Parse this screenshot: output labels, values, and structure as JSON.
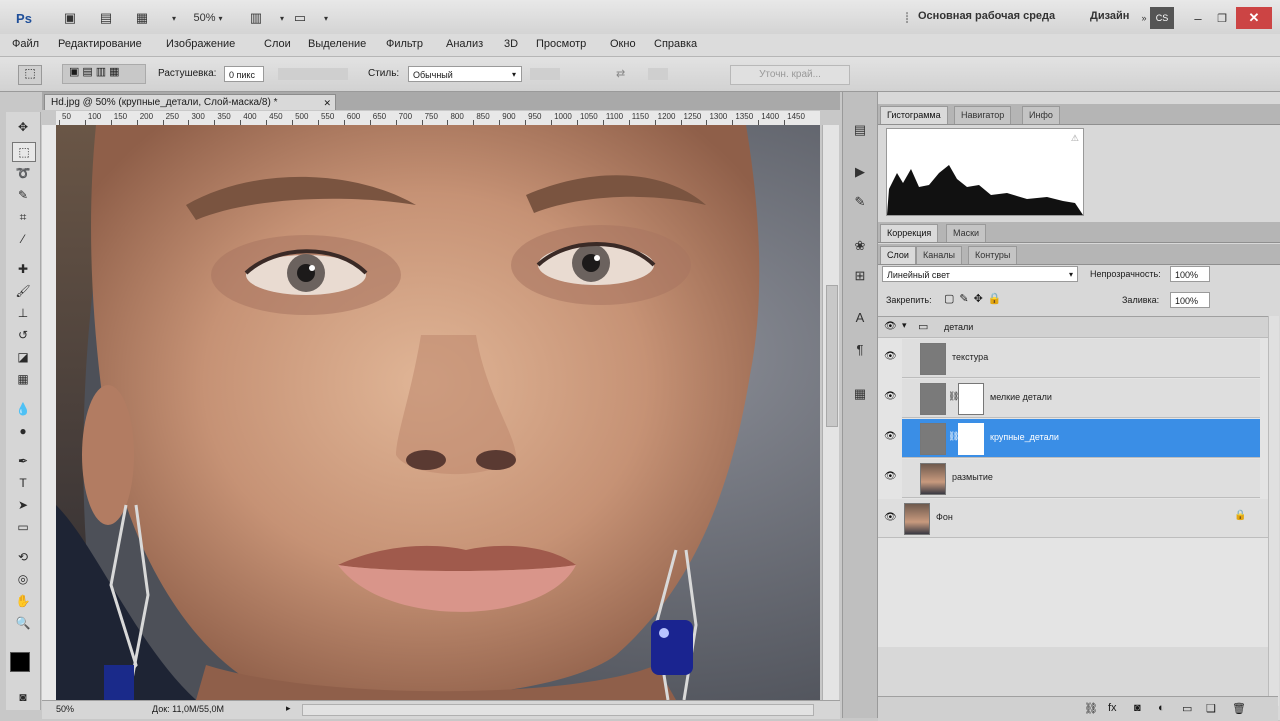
{
  "appbar": {
    "zoom": "50%",
    "workspace": "Основная рабочая среда",
    "design": "Дизайн"
  },
  "menu": [
    "Файл",
    "Редактирование",
    "Изображение",
    "Слои",
    "Выделение",
    "Фильтр",
    "Анализ",
    "3D",
    "Просмотр",
    "Окно",
    "Справка"
  ],
  "options": {
    "feather_label": "Растушевка:",
    "feather_value": "0 пикс",
    "style_label": "Стиль:",
    "style_value": "Обычный",
    "refine_edge": "Уточн. край..."
  },
  "document": {
    "tab_title": "Hd.jpg @ 50% (крупные_детали, Слой-маска/8) *",
    "ruler_ticks": [
      "50",
      "100",
      "150",
      "200",
      "250",
      "300",
      "350",
      "400",
      "450",
      "500",
      "550",
      "600",
      "650",
      "700",
      "750",
      "800",
      "850",
      "900",
      "950",
      "1000",
      "1050",
      "1100",
      "1150",
      "1200",
      "1250",
      "1300",
      "1350",
      "1400",
      "1450"
    ],
    "status_zoom": "50%",
    "status_doc": "Док: 11,0М/55,0М"
  },
  "histogram_tabs": [
    "Гистограмма",
    "Навигатор",
    "Инфо"
  ],
  "adjust_tabs": [
    "Коррекция",
    "Маски"
  ],
  "layers_tabs": [
    "Слои",
    "Каналы",
    "Контуры"
  ],
  "layers_panel": {
    "blend_mode": "Линейный свет",
    "opacity_label": "Непрозрачность:",
    "opacity_value": "100%",
    "lock_label": "Закрепить:",
    "fill_label": "Заливка:",
    "fill_value": "100%"
  },
  "layers": [
    {
      "name": "детали",
      "type": "group"
    },
    {
      "name": "текстура",
      "type": "gray"
    },
    {
      "name": "мелкие детали",
      "type": "gray-mask"
    },
    {
      "name": "крупные_детали",
      "type": "gray-mask",
      "selected": true
    },
    {
      "name": "размытие",
      "type": "photo"
    },
    {
      "name": "Фон",
      "type": "photo-locked"
    }
  ],
  "colors": {
    "selection": "#3a8ee6",
    "foreground": "#000000",
    "background": "#ffffff"
  }
}
